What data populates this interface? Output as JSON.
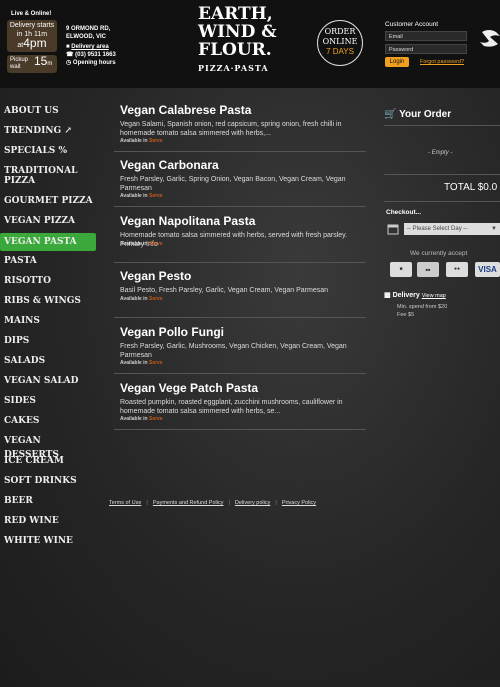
{
  "header": {
    "live_online": "Live & Online!",
    "delivery_starts": "Delivery starts",
    "delivery_in": "in 1h 11m",
    "at": "at",
    "at_time": "4pm",
    "pickup": "Pickup",
    "wait": "wait",
    "pickup_wait": "15",
    "pickup_unit": "m",
    "address_line1": "9 ORMOND RD,",
    "address_line2": "ELWOOD, VIC",
    "delivery_area": "Delivery area",
    "phone": "(03) 9531 1663",
    "opening_hours": "Opening hours",
    "logo_line1": "EARTH,",
    "logo_line2": "WIND &",
    "logo_line3": "FLOUR.",
    "logo_sub": "PIZZA·PASTA",
    "order_online_1": "ORDER",
    "order_online_2": "ONLINE",
    "order_online_3": "7 DAYS",
    "account_title": "Customer Account",
    "email_placeholder": "Email",
    "password_placeholder": "Password",
    "login": "Login",
    "forgot": "Forgot password?"
  },
  "sidebar": {
    "items": [
      {
        "label": "ABOUT US"
      },
      {
        "label": "TRENDING"
      },
      {
        "label": "SPECIALS %"
      },
      {
        "label": "TRADITIONAL PIZZA"
      },
      {
        "label": "GOURMET PIZZA"
      },
      {
        "label": "VEGAN PIZZA"
      },
      {
        "label": "VEGAN PASTA"
      },
      {
        "label": "PASTA"
      },
      {
        "label": "RISOTTO"
      },
      {
        "label": "RIBS & WINGS"
      },
      {
        "label": "MAINS"
      },
      {
        "label": "DIPS"
      },
      {
        "label": "SALADS"
      },
      {
        "label": "VEGAN SALAD"
      },
      {
        "label": "SIDES"
      },
      {
        "label": "CAKES"
      },
      {
        "label": "VEGAN DESSERTS"
      },
      {
        "label": "ICE CREAM"
      },
      {
        "label": "SOFT DRINKS"
      },
      {
        "label": "BEER"
      },
      {
        "label": "RED WINE"
      },
      {
        "label": "WHITE WINE"
      }
    ]
  },
  "menu": {
    "available_prefix": "Available in",
    "available_mode": "Serve",
    "items": [
      {
        "name": "Vegan Calabrese Pasta",
        "desc": "Vegan Salami, Spanish onion, red capsicum, spring onion, fresh chilli in homemade tomato salsa simmered with herbs,..."
      },
      {
        "name": "Vegan Carbonara",
        "desc": "Fresh Parsley, Garlic, Spring Onion, Vegan Bacon, Vegan Cream, Vegan Parmesan"
      },
      {
        "name": "Vegan Napolitana Pasta",
        "desc": "Homemade tomato salsa simmered with herbs, served with fresh parsley. Primary Info"
      },
      {
        "name": "Vegan Pesto",
        "desc": "Basil Pesto, Fresh Parsley, Garlic, Vegan Cream, Vegan Parmesan"
      },
      {
        "name": "Vegan Pollo Fungi",
        "desc": "Fresh Parsley, Garlic, Mushrooms, Vegan Chicken, Vegan Cream, Vegan Parmesan"
      },
      {
        "name": "Vegan Vege Patch Pasta",
        "desc": "Roasted pumpkin, roasted eggplant, zucchini mushrooms, cauliflower in homemade tomato salsa simmered with herbs, se..."
      }
    ]
  },
  "footer": {
    "terms": "Terms of Use",
    "payments": "Payments and Refund Policy",
    "delivery_policy": "Delivery policy",
    "privacy": "Privacy Policy"
  },
  "cart": {
    "title": "Your Order",
    "empty": "- Empty -",
    "total": "TOTAL $0.0",
    "checkout": "Checkout...",
    "select_day": "-- Please Select Day --",
    "accept": "We currently accept",
    "cards": [
      "VISA"
    ],
    "delivery": "Delivery",
    "view_map": "View map",
    "min_spend": "Min. spend from $20",
    "fee": "Fee $5"
  },
  "colors": {
    "accent": "#f0a020",
    "active_nav": "#3aa83a",
    "available": "#c85a1a"
  }
}
